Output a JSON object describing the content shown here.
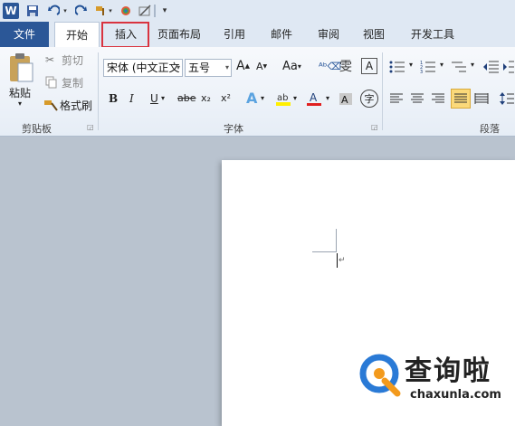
{
  "qat": {
    "app_icon": "W"
  },
  "tabs": {
    "file": "文件",
    "home": "开始",
    "insert": "插入",
    "page_layout": "页面布局",
    "references": "引用",
    "mailings": "邮件",
    "review": "审阅",
    "view": "视图",
    "developer": "开发工具"
  },
  "clipboard": {
    "paste": "粘贴",
    "cut": "剪切",
    "copy": "复制",
    "format_painter": "格式刷",
    "group": "剪贴板"
  },
  "font": {
    "name": "宋体 (中文正文",
    "size": "五号",
    "group": "字体",
    "bold": "B",
    "italic": "I",
    "underline": "U",
    "strike": "abe",
    "sub": "x₂",
    "sup": "x²",
    "aa": "Aa",
    "grow": "A",
    "shrink": "A",
    "wen": "雯",
    "a_box": "A",
    "phonetic": "字"
  },
  "paragraph": {
    "group": "段落"
  },
  "watermark": {
    "brand": "查询啦",
    "url": "chaxunla.com"
  },
  "colors": {
    "accent": "#2b5797",
    "highlight_box": "#d9333f",
    "wm_blue": "#2a7ad6",
    "wm_orange": "#f39a1c"
  }
}
